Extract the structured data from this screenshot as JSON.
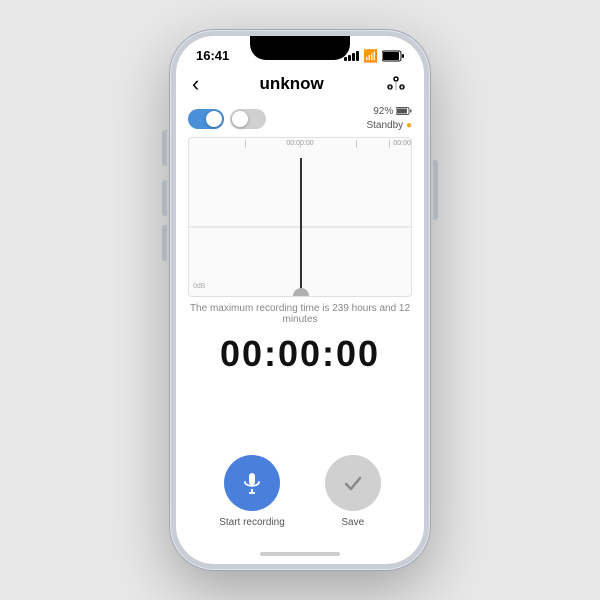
{
  "statusBar": {
    "time": "16:41",
    "batteryPercent": "92%",
    "signalBars": [
      4,
      6,
      8,
      10
    ]
  },
  "nav": {
    "backLabel": "‹",
    "title": "unknow",
    "settingsIcon": "⊞"
  },
  "toggles": {
    "toggle1State": "on",
    "toggle2State": "off"
  },
  "batteryStatus": {
    "percent": "92%",
    "status": "Standby"
  },
  "waveform": {
    "centerTime": "00:00:00",
    "endTime": "00:00",
    "label": "0dB"
  },
  "maxTimeText": "The maximum recording time is 239 hours and 12 minutes",
  "timer": "00:00:00",
  "buttons": {
    "record": {
      "label": "Start recording"
    },
    "save": {
      "label": "Save"
    }
  }
}
